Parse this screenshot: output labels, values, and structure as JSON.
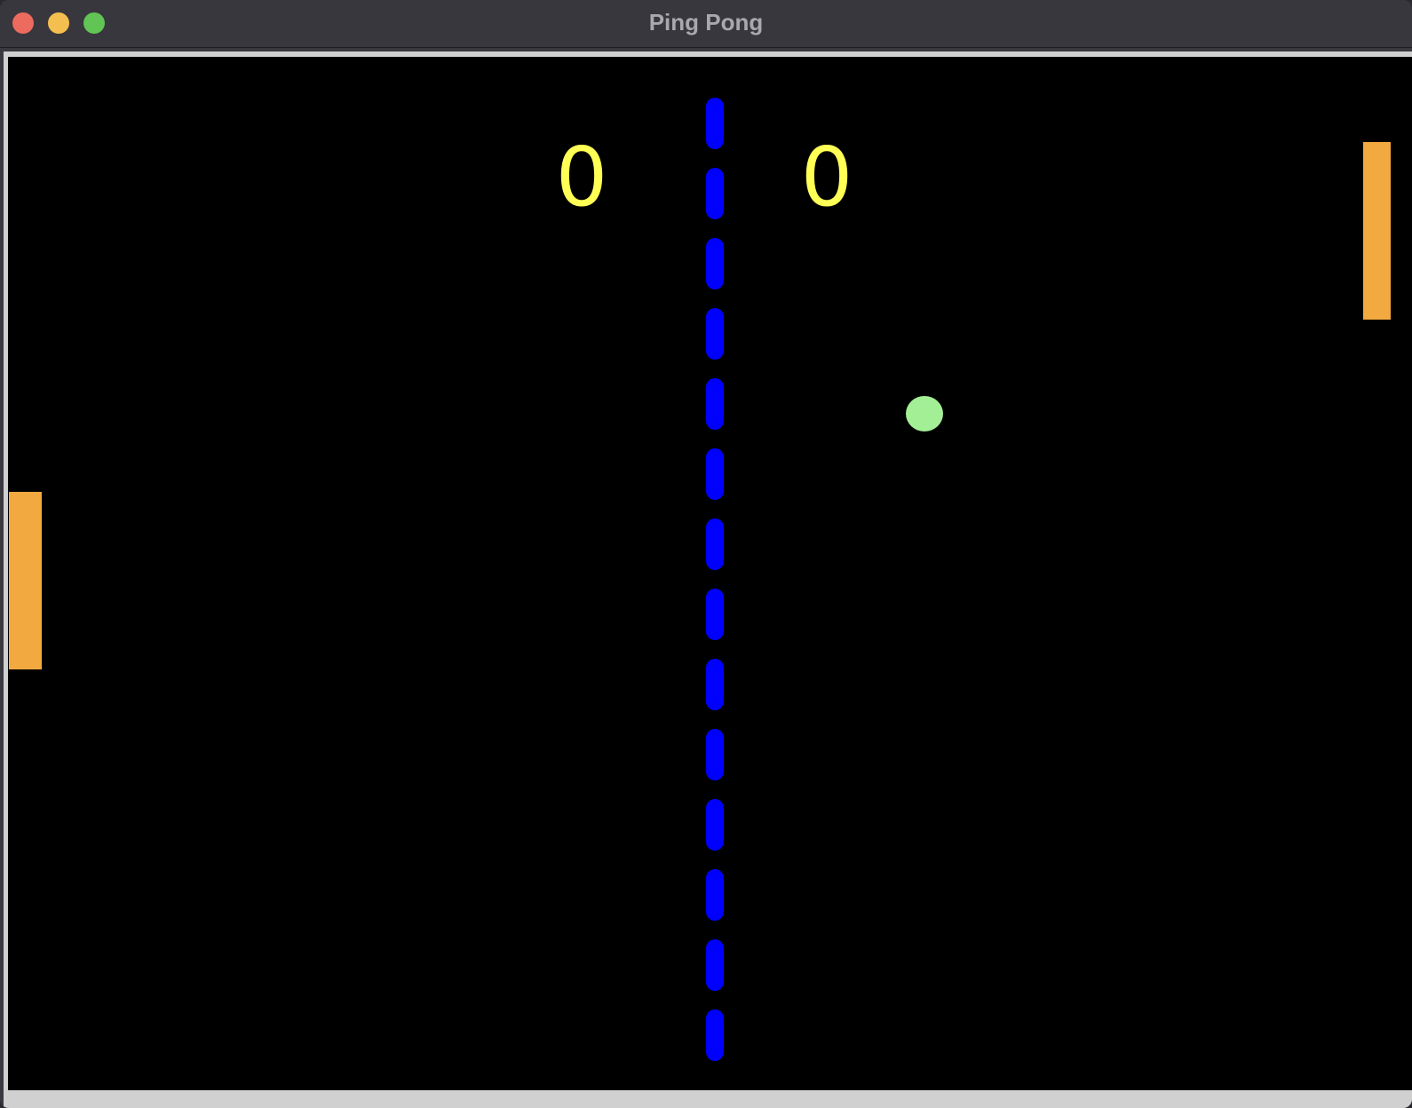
{
  "window": {
    "title": "Ping Pong"
  },
  "game": {
    "score_left": "0",
    "score_right": "0",
    "colors": {
      "background": "#000000",
      "net": "#0000ff",
      "score": "#ffff55",
      "paddle": "#f2a93f",
      "ball": "#a3ef95"
    }
  }
}
